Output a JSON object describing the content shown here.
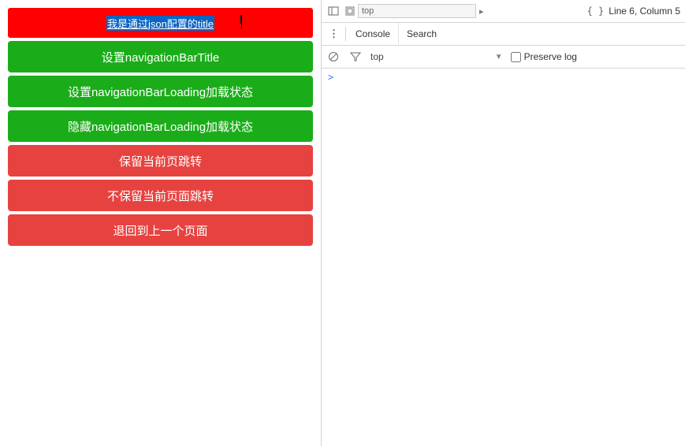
{
  "titlebar": {
    "text_selected": "我是通过json配置的title"
  },
  "buttons": {
    "b1": "设置navigationBarTitle",
    "b2": "设置navigationBarLoading加载状态",
    "b3": "隐藏navigationBarLoading加载状态",
    "b4": "保留当前页跳转",
    "b5": "不保留当前页面跳转",
    "b6": "退回到上一个页面"
  },
  "devtools": {
    "breadcrumb_value": "top",
    "status_line": "Line 6, Column 5",
    "tabs": {
      "console": "Console",
      "search": "Search"
    },
    "context_label": "top",
    "preserve_label": "Preserve log",
    "prompt": ">"
  }
}
